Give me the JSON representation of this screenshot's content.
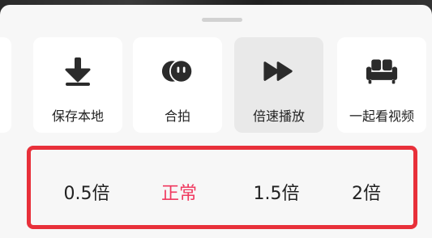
{
  "colors": {
    "sheet_background": "#f7f7f7",
    "tile_background": "#ffffff",
    "active_tile_background": "#e9e9e9",
    "icon_color": "#2b2b2b",
    "selected_speed_color": "#f0395f",
    "highlight_border_color": "#e8303a"
  },
  "actions": [
    {
      "label": "保存本地",
      "icon": "download-arrow-icon"
    },
    {
      "label": "合拍",
      "icon": "duet-icon"
    },
    {
      "label": "倍速播放",
      "icon": "fast-forward-icon",
      "active": true
    },
    {
      "label": "一起看视频",
      "icon": "sofa-icon"
    }
  ],
  "speed_options": [
    {
      "label": "0.5倍",
      "selected": false
    },
    {
      "label": "正常",
      "selected": true
    },
    {
      "label": "1.5倍",
      "selected": false
    },
    {
      "label": "2倍",
      "selected": false
    }
  ],
  "selected_speed": "正常"
}
